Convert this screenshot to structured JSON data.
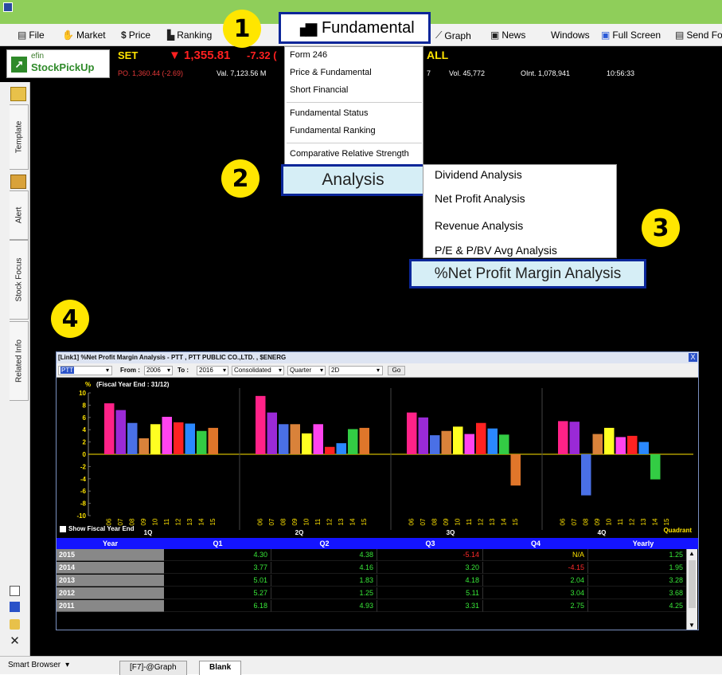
{
  "menubar": {
    "items": [
      "File",
      "Market",
      "Price",
      "Ranking",
      "Graph",
      "News",
      "Windows",
      "Full Screen",
      "Send Fo"
    ],
    "fundamental_label": "Fundamental"
  },
  "quote": {
    "index_name": "SET",
    "index_value": "▼ 1,355.81",
    "index_change": "-7.32 (",
    "po": "PO. 1,360.44 (-2.69)",
    "val": "Val. 7,123.56 M",
    "all": "ALL",
    "seven": "7",
    "vol": "Vol. 45,772",
    "oint": "OInt. 1,078,941",
    "time": "10:56:33"
  },
  "logo": {
    "top": "efin",
    "bottom": "StockPickUp"
  },
  "side_tabs": [
    "Template",
    "Alert",
    "Stock Focus",
    "Related Info"
  ],
  "fundamental_menu": {
    "items": [
      "Form 246",
      "Price & Fundamental",
      "Short Financial",
      "Fundamental Status",
      "Fundamental Ranking",
      "Comparative Relative Strength"
    ]
  },
  "analysis_label": "Analysis",
  "analysis_submenu": [
    "Dividend Analysis",
    "Net Profit Analysis",
    "Revenue Analysis",
    "P/E & P/BV Avg Analysis"
  ],
  "npm_label": "%Net Profit Margin Analysis",
  "badges": [
    "1",
    "2",
    "3",
    "4"
  ],
  "chart_window": {
    "title": "[Link1] %Net Profit Margin Analysis - PTT , PTT PUBLIC CO.,LTD. , $ENERG",
    "symbol": "PTT",
    "from_label": "From :",
    "from_value": "2006",
    "to_label": "To :",
    "to_value": "2016",
    "consolidated": "Consolidated",
    "period": "Quarter",
    "dim": "2D",
    "go": "Go",
    "close": "X",
    "show_fiscal": "Show Fiscal Year End",
    "quadrant": "Quadrant"
  },
  "chart_data": {
    "type": "bar",
    "title": "(Fiscal Year End : 31/12)",
    "ylabel": "%",
    "ylim": [
      -10,
      10
    ],
    "yticks": [
      10,
      8,
      6,
      4,
      2,
      0,
      -2,
      -4,
      -6,
      -8,
      -10
    ],
    "groups": [
      "1Q",
      "2Q",
      "3Q",
      "4Q"
    ],
    "categories": [
      "06",
      "07",
      "08",
      "09",
      "10",
      "11",
      "12",
      "13",
      "14",
      "15"
    ],
    "colors": [
      "#ff2288",
      "#9a2ad6",
      "#4a70e6",
      "#d9823a",
      "#ffff22",
      "#ff44ee",
      "#ff2222",
      "#2a88ff",
      "#33cc44",
      "#e0762a"
    ],
    "series": [
      {
        "values": [
          8.3,
          7.2,
          5.1,
          2.6,
          4.9,
          6.1,
          5.2,
          5.0,
          3.8,
          4.3
        ]
      },
      {
        "values": [
          9.5,
          6.8,
          4.9,
          4.9,
          3.4,
          4.9,
          1.2,
          1.8,
          4.1,
          4.3
        ]
      },
      {
        "values": [
          6.8,
          6.0,
          3.1,
          3.8,
          4.5,
          3.3,
          5.1,
          4.2,
          3.2,
          -5.1
        ]
      },
      {
        "values": [
          5.4,
          5.3,
          -6.7,
          3.3,
          4.3,
          2.8,
          3.0,
          2.0,
          -4.1,
          null
        ]
      }
    ]
  },
  "table": {
    "headers": [
      "Year",
      "Q1",
      "Q2",
      "Q3",
      "Q4",
      "Yearly"
    ],
    "rows": [
      {
        "year": "2015",
        "q1": "4.30",
        "q2": "4.38",
        "q3": "-5.14",
        "q4": "N/A",
        "yearly": "1.25"
      },
      {
        "year": "2014",
        "q1": "3.77",
        "q2": "4.16",
        "q3": "3.20",
        "q4": "-4.15",
        "yearly": "1.95"
      },
      {
        "year": "2013",
        "q1": "5.01",
        "q2": "1.83",
        "q3": "4.18",
        "q4": "2.04",
        "yearly": "3.28"
      },
      {
        "year": "2012",
        "q1": "5.27",
        "q2": "1.25",
        "q3": "5.11",
        "q4": "3.04",
        "yearly": "3.68"
      },
      {
        "year": "2011",
        "q1": "6.18",
        "q2": "4.93",
        "q3": "3.31",
        "q4": "2.75",
        "yearly": "4.25"
      }
    ]
  },
  "bottom": {
    "smart_browser": "Smart Browser",
    "tab1": "[F7]-@Graph",
    "tab2": "Blank"
  }
}
